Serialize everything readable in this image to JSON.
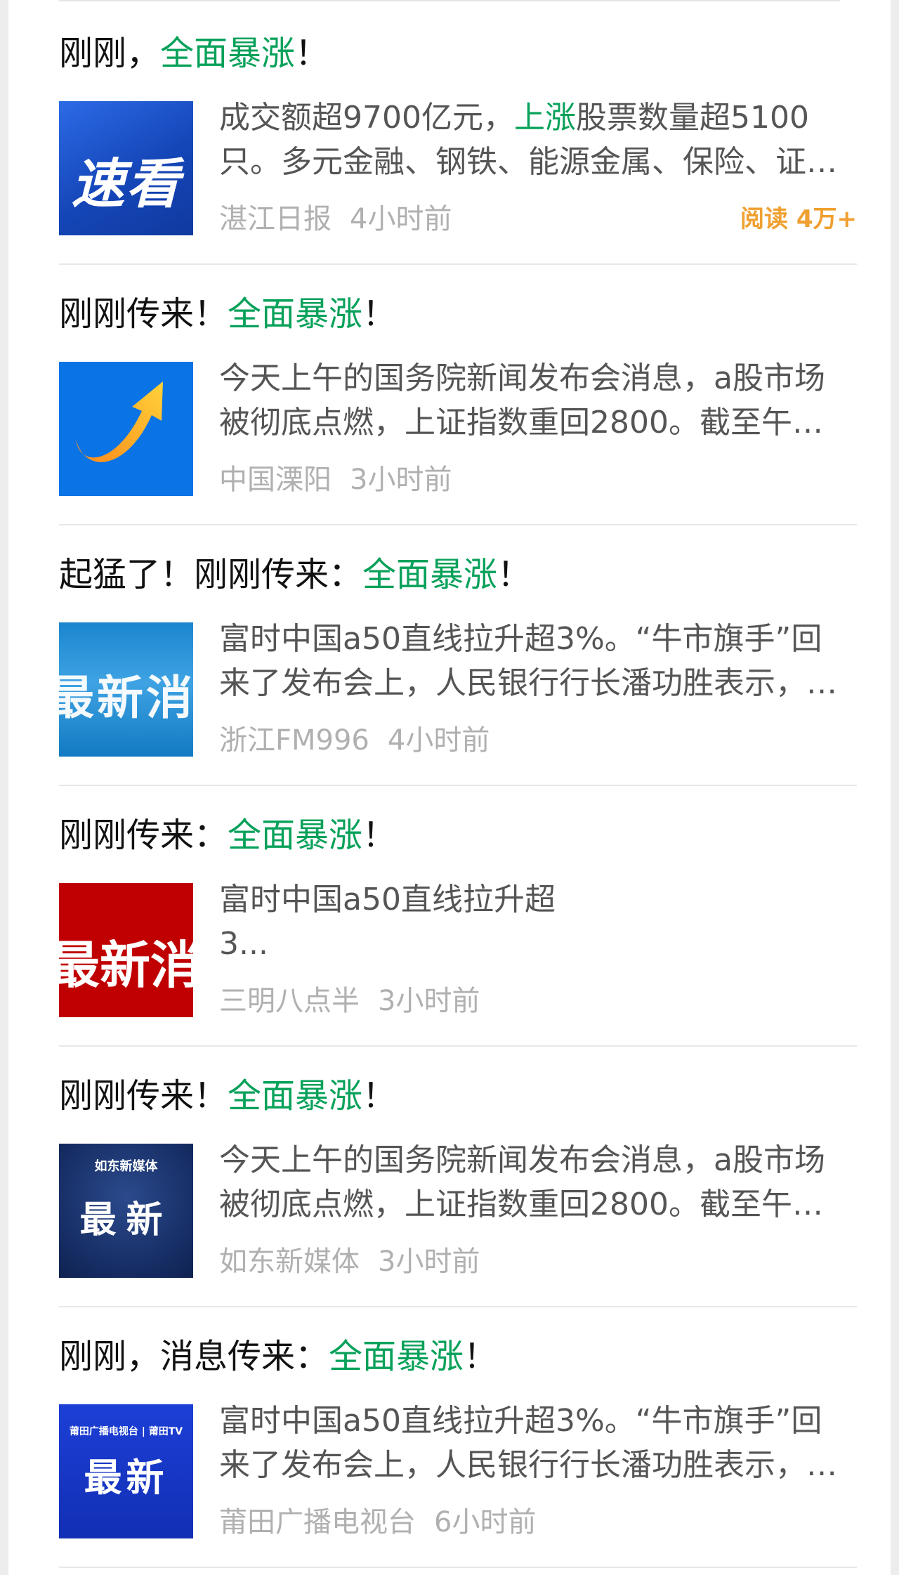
{
  "articles": [
    {
      "title_prefix": "刚刚，",
      "title_highlight": "全面暴涨",
      "title_suffix": "！",
      "thumb_text": "速看",
      "summary_before": "成交额超9700亿元，",
      "summary_highlight": "上涨",
      "summary_after": "股票数量超5100只。多元金融、钢铁、能源金属、保险、证…",
      "source": "湛江日报",
      "time": "4小时前",
      "reads": "阅读 4万+"
    },
    {
      "title_prefix": "刚刚传来！",
      "title_highlight": "全面暴涨",
      "title_suffix": "！",
      "thumb_icon": "rising-arrow-icon",
      "summary": "今天上午的国务院新闻发布会消息，a股市场被彻底点燃，上证指数重回2800。截至午…",
      "source": "中国溧阳",
      "time": "3小时前"
    },
    {
      "title_prefix": "起猛了！刚刚传来：",
      "title_highlight": "全面暴涨",
      "title_suffix": "！",
      "thumb_text": "最新消息",
      "summary": "富时中国a50直线拉升超3%。“牛市旗手”回来了发布会上，人民银行行长潘功胜表示，…",
      "source": "浙江FM996",
      "time": "4小时前"
    },
    {
      "title_prefix": "刚刚传来：",
      "title_highlight": "全面暴涨",
      "title_suffix": "！",
      "thumb_text": "最新消息",
      "summary_line1": "富时中国a50直线拉升超",
      "summary_line2": "3...",
      "source": "三明八点半",
      "time": "3小时前"
    },
    {
      "title_prefix": "刚刚传来！",
      "title_highlight": "全面暴涨",
      "title_suffix": "！",
      "thumb_brand": "如东新媒体",
      "thumb_text": "最新",
      "summary": "今天上午的国务院新闻发布会消息，a股市场被彻底点燃，上证指数重回2800。截至午…",
      "source": "如东新媒体",
      "time": "3小时前"
    },
    {
      "title_prefix": "刚刚，消息传来：",
      "title_highlight": "全面暴涨",
      "title_suffix": "！",
      "thumb_brand": "莆田广播电视台 | 莆田TV",
      "thumb_text": "最新",
      "summary": "富时中国a50直线拉升超3%。“牛市旗手”回来了发布会上，人民银行行长潘功胜表示，…",
      "source": "莆田广播电视台",
      "time": "6小时前"
    }
  ],
  "colors": {
    "highlight": "#07a15a",
    "reads": "#f0a030",
    "meta": "#b0b0b0",
    "summary": "#555555"
  }
}
